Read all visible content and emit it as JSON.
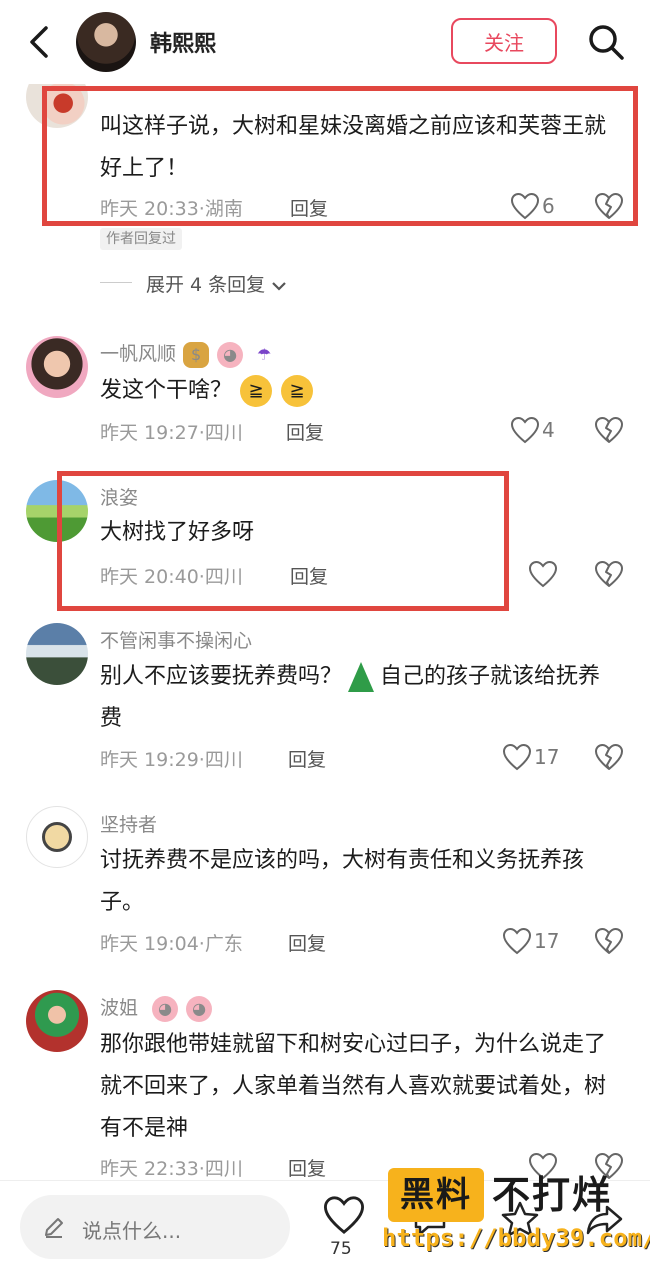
{
  "header": {
    "user_name": "韩熙熙",
    "follow_label": "关注"
  },
  "comments": [
    {
      "name": "",
      "text": "叫这样子说，大树和星妹没离婚之前应该和芙蓉王就好上了！",
      "time": "昨天 20:33",
      "location": "湖南",
      "reply_label": "回复",
      "likes": "6",
      "author_replied": "作者回复过",
      "expand_label": "展开 4 条回复"
    },
    {
      "name": "一帆风顺",
      "text": "发这个干啥？",
      "time": "昨天 19:27",
      "location": "四川",
      "reply_label": "回复",
      "likes": "4"
    },
    {
      "name": "浪姿",
      "text": "大树找了好多呀",
      "time": "昨天 20:40",
      "location": "四川",
      "reply_label": "回复",
      "likes": ""
    },
    {
      "name": "不管闲事不操闲心",
      "text_before": "别人不应该要抚养费吗？",
      "text_after": "自己的孩子就该给抚养费",
      "time": "昨天 19:29",
      "location": "四川",
      "reply_label": "回复",
      "likes": "17"
    },
    {
      "name": "坚持者",
      "text": "讨抚养费不是应该的吗，大树有责任和义务抚养孩子。",
      "time": "昨天 19:04",
      "location": "广东",
      "reply_label": "回复",
      "likes": "17"
    },
    {
      "name": "波姐",
      "text": "那你跟他带娃就留下和树安心过曰子，为什么说走了就不回来了，人家单着当然有人喜欢就要试着处，树有不是神",
      "time": "昨天 22:33",
      "location": "四川",
      "reply_label": "回复",
      "likes": ""
    }
  ],
  "bottom_bar": {
    "input_placeholder": "说点什么...",
    "like_count": "75"
  },
  "watermark": {
    "badge": "黑料",
    "rest": "不打烊",
    "url": "https://bbdy39.com/"
  },
  "colors": {
    "accent": "#e8485e",
    "highlight_box": "#e0463f",
    "watermark": "#f7b21c"
  },
  "icons": {
    "back": "chevron-left-icon",
    "search": "search-icon",
    "like": "heart-icon",
    "dislike": "broken-heart-icon",
    "compose": "pen-icon",
    "comment": "comment-icon",
    "favorite": "star-icon",
    "share": "share-icon"
  }
}
